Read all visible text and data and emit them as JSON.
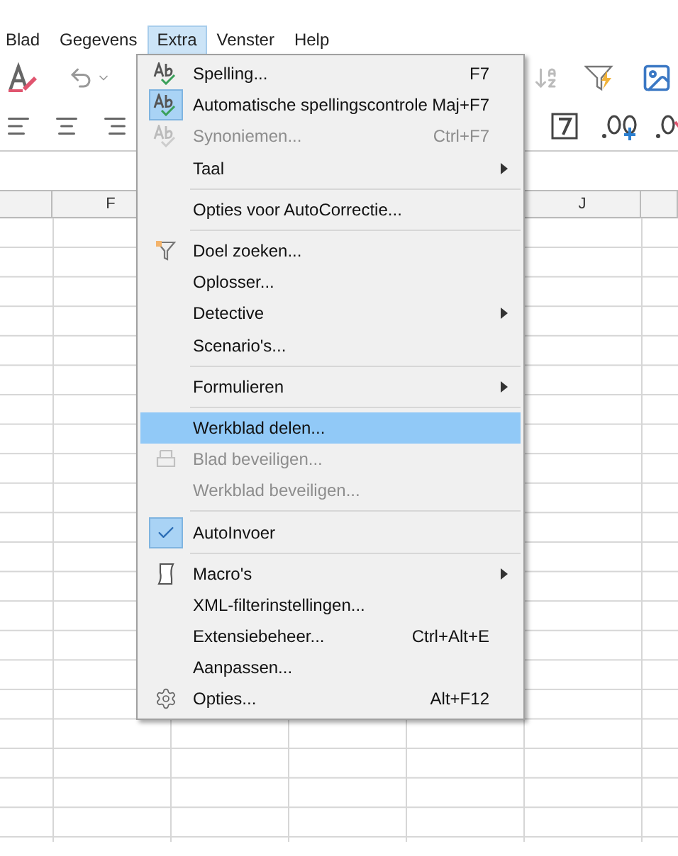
{
  "menubar": [
    {
      "label": "Blad",
      "selected": false
    },
    {
      "label": "Gegevens",
      "selected": false
    },
    {
      "label": "Extra",
      "selected": true
    },
    {
      "label": "Venster",
      "selected": false
    },
    {
      "label": "Help",
      "selected": false
    }
  ],
  "column_headers": [
    "F",
    "J"
  ],
  "menu": {
    "items": [
      {
        "kind": "item",
        "label": "Spelling...",
        "shortcut": "F7",
        "submenu": false,
        "disabled": false,
        "checked": false,
        "selected": false
      },
      {
        "kind": "item",
        "label": "Automatische spellingscontrole",
        "shortcut": "Maj+F7",
        "submenu": false,
        "disabled": false,
        "checked": true,
        "selected": false
      },
      {
        "kind": "item",
        "label": "Synoniemen...",
        "shortcut": "Ctrl+F7",
        "submenu": false,
        "disabled": true,
        "checked": false,
        "selected": false
      },
      {
        "kind": "item",
        "label": "Taal",
        "submenu": true,
        "disabled": false,
        "checked": false,
        "selected": false
      },
      {
        "kind": "separator"
      },
      {
        "kind": "item",
        "label": "Opties voor AutoCorrectie...",
        "submenu": false,
        "disabled": false,
        "checked": false,
        "selected": false
      },
      {
        "kind": "separator"
      },
      {
        "kind": "item",
        "label": "Doel zoeken...",
        "submenu": false,
        "disabled": false,
        "checked": false,
        "selected": false
      },
      {
        "kind": "item",
        "label": "Oplosser...",
        "submenu": false,
        "disabled": false,
        "checked": false,
        "selected": false
      },
      {
        "kind": "item",
        "label": "Detective",
        "submenu": true,
        "disabled": false,
        "checked": false,
        "selected": false
      },
      {
        "kind": "item",
        "label": "Scenario's...",
        "submenu": false,
        "disabled": false,
        "checked": false,
        "selected": false
      },
      {
        "kind": "separator"
      },
      {
        "kind": "item",
        "label": "Formulieren",
        "submenu": true,
        "disabled": false,
        "checked": false,
        "selected": false
      },
      {
        "kind": "separator"
      },
      {
        "kind": "item",
        "label": "Werkblad delen...",
        "submenu": false,
        "disabled": false,
        "checked": false,
        "selected": true
      },
      {
        "kind": "item",
        "label": "Blad beveiligen...",
        "submenu": false,
        "disabled": true,
        "checked": false,
        "selected": false
      },
      {
        "kind": "item",
        "label": "Werkblad beveiligen...",
        "submenu": false,
        "disabled": true,
        "checked": false,
        "selected": false
      },
      {
        "kind": "separator"
      },
      {
        "kind": "item",
        "label": "AutoInvoer",
        "submenu": false,
        "disabled": false,
        "checked": true,
        "selected": false
      },
      {
        "kind": "separator"
      },
      {
        "kind": "item",
        "label": "Macro's",
        "submenu": true,
        "disabled": false,
        "checked": false,
        "selected": false
      },
      {
        "kind": "item",
        "label": "XML-filterinstellingen...",
        "submenu": false,
        "disabled": false,
        "checked": false,
        "selected": false
      },
      {
        "kind": "item",
        "label": "Extensiebeheer...",
        "shortcut": "Ctrl+Alt+E",
        "submenu": false,
        "disabled": false,
        "checked": false,
        "selected": false
      },
      {
        "kind": "item",
        "label": "Aanpassen...",
        "submenu": false,
        "disabled": false,
        "checked": false,
        "selected": false
      },
      {
        "kind": "item",
        "label": "Opties...",
        "shortcut": "Alt+F12",
        "submenu": false,
        "disabled": false,
        "checked": false,
        "selected": false
      }
    ]
  }
}
